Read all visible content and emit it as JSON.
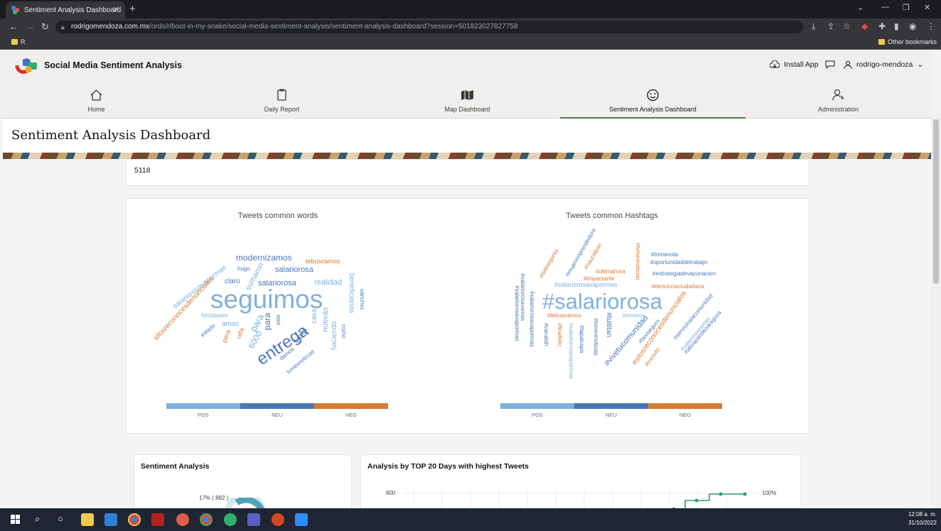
{
  "browser": {
    "tab_title": "Sentiment Analysis Dashboard",
    "url_host": "rodrigomendoza.com.mx",
    "url_path": "/ords/r/boot-in-my-snake/social-media-sentiment-analysis/sentiment-analysis-dashboard?session=501823027827758",
    "bookmark_folder": "R",
    "other_bookmarks": "Other bookmarks"
  },
  "app": {
    "title": "Social Media Sentiment Analysis",
    "install_app": "Install App",
    "user": "rodrigo-mendoza"
  },
  "nav": [
    {
      "label": "Home",
      "icon": "home-icon"
    },
    {
      "label": "Daily Report",
      "icon": "clipboard-icon"
    },
    {
      "label": "Map Dashboard",
      "icon": "map-icon"
    },
    {
      "label": "Sentiment Analysis Dashboard",
      "icon": "smiley-icon",
      "active": true
    },
    {
      "label": "Administration",
      "icon": "user-gear-icon"
    }
  ],
  "page": {
    "title": "Sentiment Analysis Dashboard",
    "tweets_count": "5118"
  },
  "clouds": {
    "words_title": "Tweets common words",
    "hashtags_title": "Tweets common Hashtags",
    "legend": [
      "POS",
      "NEU",
      "NEG"
    ],
    "colors": {
      "pos": "#7fb1dc",
      "neu": "#4a77b8",
      "neg": "#d77a35"
    }
  },
  "panels": {
    "sentiment_title": "Sentiment Analysis",
    "sentiment_label": "17% ( 882 )",
    "top20_title": "Analysis by TOP 20 Days with highest Tweets",
    "top20_ytick": "800",
    "top20_pct": "100%"
  },
  "taskbar": {
    "time": "12:08 a. m.",
    "date": "31/10/2022"
  }
}
